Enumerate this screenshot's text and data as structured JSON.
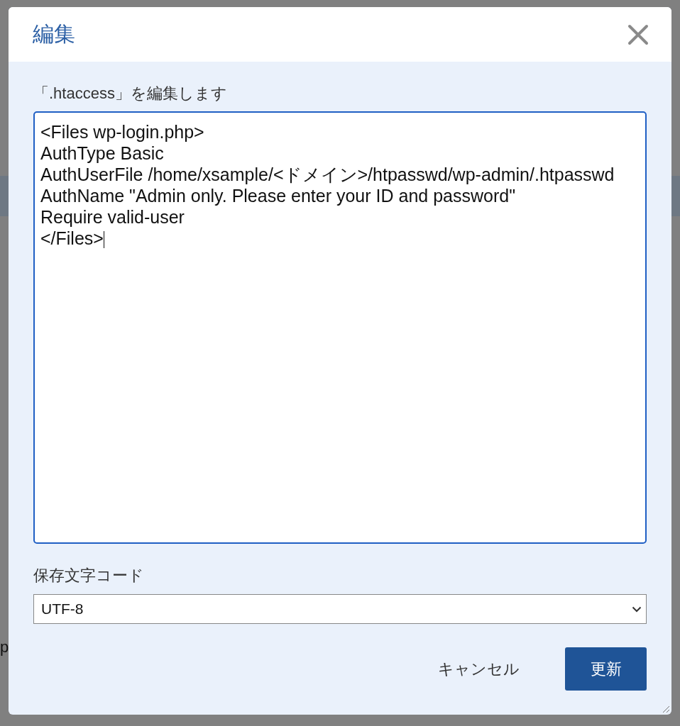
{
  "background": {
    "text_fragment": "p"
  },
  "dialog": {
    "title": "編集",
    "description": "「.htaccess」を編集します",
    "editor": {
      "value": "<Files wp-login.php>\nAuthType Basic\nAuthUserFile /home/xsample/<ドメイン>/htpasswd/wp-admin/.htpasswd\nAuthName \"Admin only. Please enter your ID and password\"\nRequire valid-user\n</Files>"
    },
    "encoding": {
      "label": "保存文字コード",
      "value": "UTF-8"
    },
    "buttons": [
      {
        "label": "キャンセル",
        "kind": "secondary"
      },
      {
        "label": "更新",
        "kind": "primary"
      }
    ]
  }
}
